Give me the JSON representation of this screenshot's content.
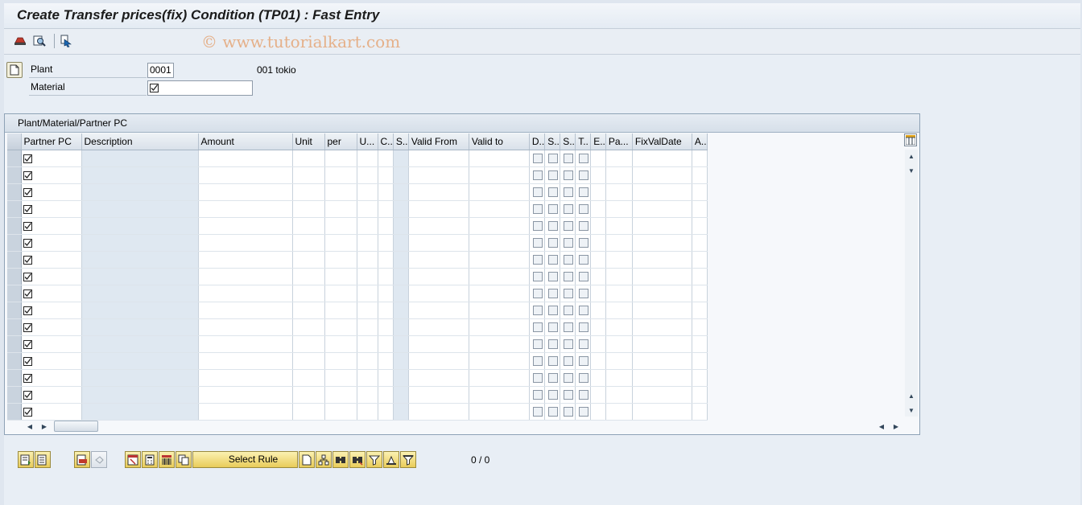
{
  "window": {
    "title": "Create Transfer prices(fix) Condition (TP01) : Fast Entry",
    "watermark": "© www.tutorialkart.com"
  },
  "toolbar": {
    "icons": [
      "condition-info-icon",
      "display-details-icon",
      "copy-cursor-icon"
    ]
  },
  "selection": {
    "plant_label": "Plant",
    "plant_value": "0001",
    "plant_description": "001 tokio",
    "material_label": "Material",
    "material_value": ""
  },
  "panel": {
    "title": "Plant/Material/Partner PC"
  },
  "table": {
    "columns": [
      "Partner PC",
      "Description",
      "Amount",
      "Unit",
      "per",
      "U...",
      "C..",
      "S..",
      "Valid From",
      "Valid to",
      "D..",
      "S..",
      "S..",
      "T..",
      "E..",
      "Pa...",
      "FixValDate",
      "A.."
    ],
    "row_count": 16
  },
  "bottom_toolbar": {
    "select_rule_label": "Select Rule",
    "pager_text": "0  /  0"
  },
  "colors": {
    "background": "#dfe6ef",
    "accent_button": "#f0d873",
    "readonly_column": "#dfe8f1"
  }
}
